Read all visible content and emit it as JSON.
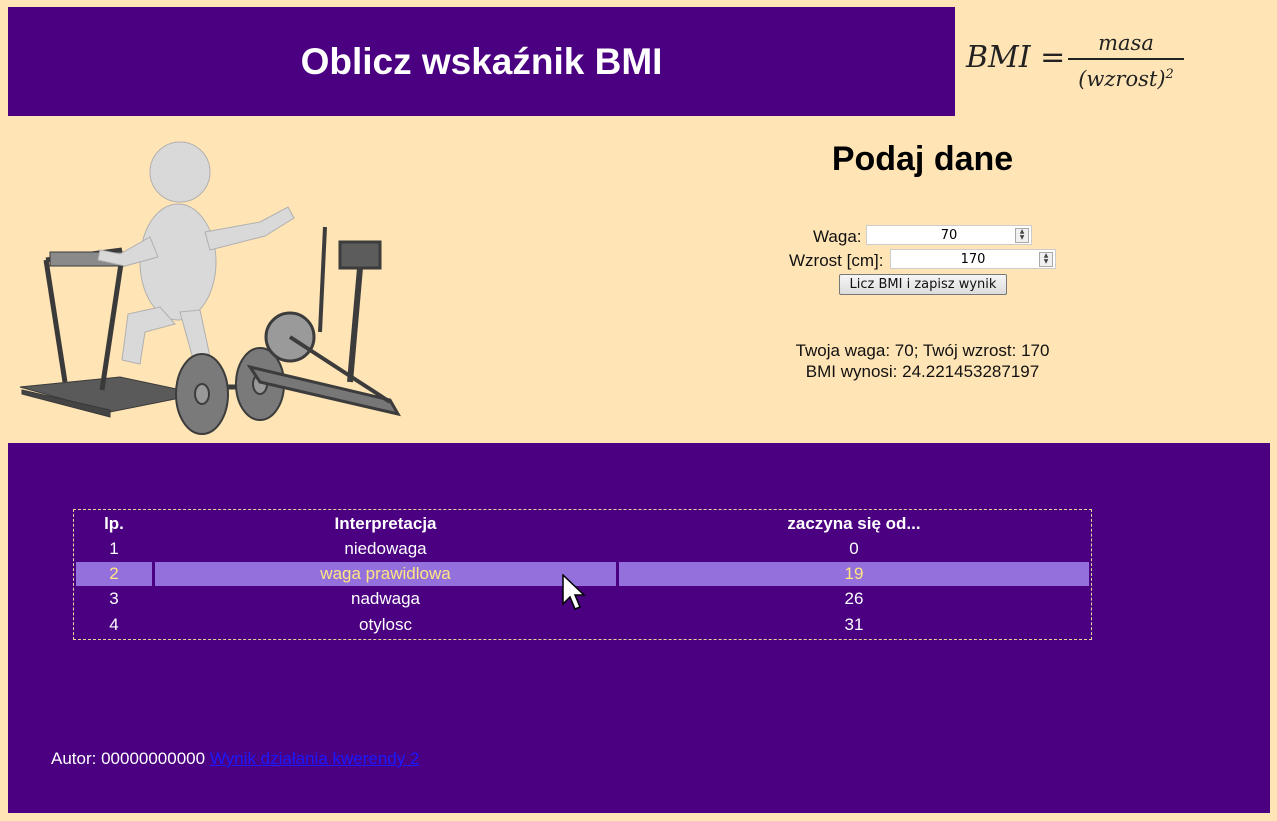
{
  "header": {
    "title": "Oblicz wskaźnik BMI"
  },
  "formula": {
    "lhs": "BMI =",
    "numerator": "masa",
    "denominator": "(wzrost)",
    "exponent": "2"
  },
  "form": {
    "heading": "Podaj dane",
    "weight_label": "Waga:",
    "weight_value": "70",
    "height_label": "Wzrost [cm]:",
    "height_value": "170",
    "submit_label": "Licz BMI i zapisz wynik"
  },
  "result": {
    "line1": "Twoja waga: 70; Twój wzrost: 170",
    "line2": "BMI wynosi: 24.221453287197"
  },
  "table": {
    "headers": [
      "lp.",
      "Interpretacja",
      "zaczyna się od..."
    ],
    "rows": [
      [
        "1",
        "niedowaga",
        "0"
      ],
      [
        "2",
        "waga prawidlowa",
        "19"
      ],
      [
        "3",
        "nadwaga",
        "26"
      ],
      [
        "4",
        "otylosc",
        "31"
      ]
    ],
    "highlight_color": "#9370db",
    "highlight_text_color": "#ffe680"
  },
  "footer": {
    "author_text": "Autor: 00000000000",
    "link_text": "Wynik działania kwerendy 2"
  },
  "colors": {
    "page_bg": "#ffe4b5",
    "panel_bg": "#4b0082"
  }
}
